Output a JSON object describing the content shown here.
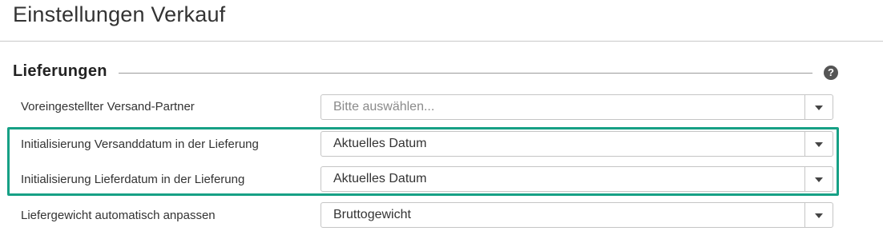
{
  "page": {
    "title": "Einstellungen Verkauf"
  },
  "section": {
    "heading": "Lieferungen",
    "help_icon": "question-circle-icon"
  },
  "rows": [
    {
      "label": "Voreingestellter Versand-Partner",
      "value": "Bitte auswählen...",
      "is_placeholder": true
    },
    {
      "label": "Initialisierung Versanddatum in der Lieferung",
      "value": "Aktuelles Datum",
      "is_placeholder": false
    },
    {
      "label": "Initialisierung Lieferdatum in der Lieferung",
      "value": "Aktuelles Datum",
      "is_placeholder": false
    },
    {
      "label": "Liefergewicht automatisch anpassen",
      "value": "Bruttogewicht",
      "is_placeholder": false
    }
  ],
  "colors": {
    "highlight": "#16a085"
  }
}
